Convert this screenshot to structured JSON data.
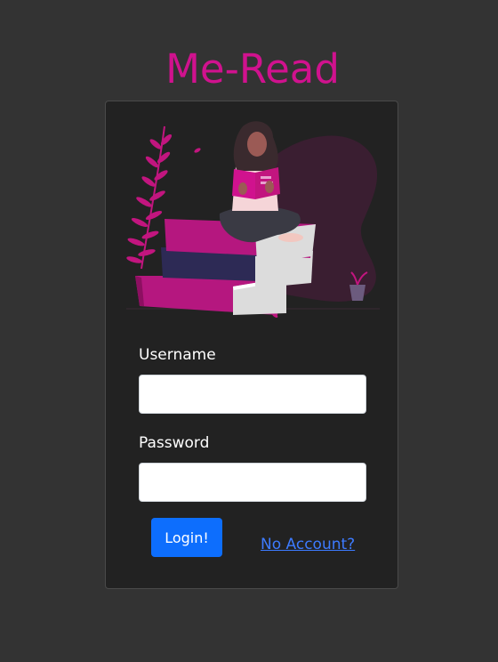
{
  "app": {
    "title": "Me-Read",
    "accent_color": "#d0128e"
  },
  "hero": {
    "illustration": "woman-reading-on-books-illustration"
  },
  "form": {
    "username_label": "Username",
    "username_value": "",
    "password_label": "Password",
    "password_value": "",
    "login_label": "Login!",
    "no_account_label": "No Account?"
  },
  "colors": {
    "background": "#333333",
    "card": "#222222",
    "button": "#0d6efd",
    "link": "#3d7bff"
  }
}
